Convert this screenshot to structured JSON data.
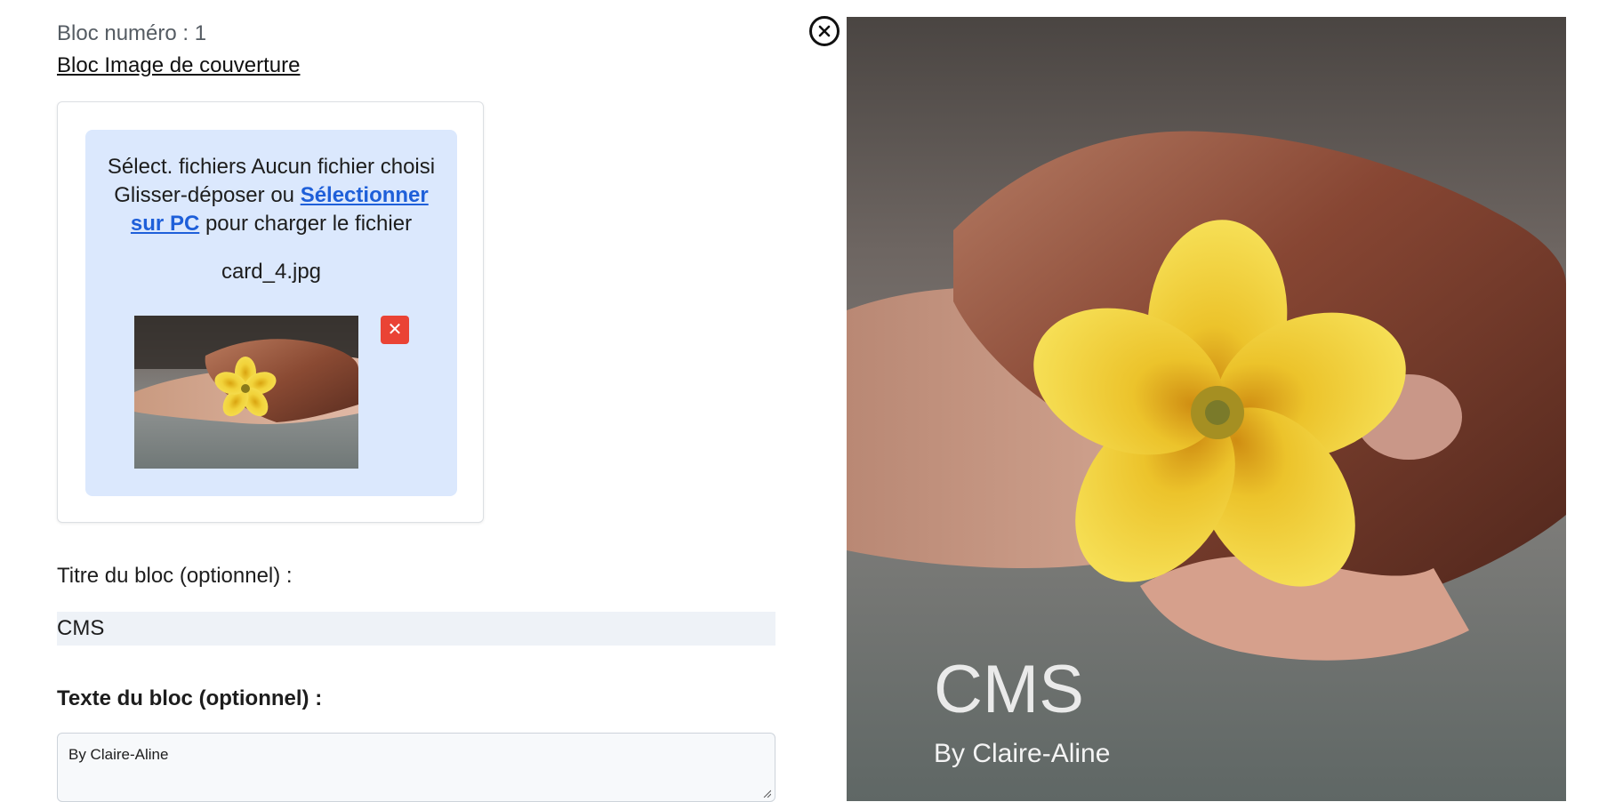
{
  "block": {
    "number_label": "Bloc numéro : 1",
    "type_link": "Bloc Image de couverture"
  },
  "upload": {
    "native_button": "Sélect. fichiers",
    "native_status": "Aucun fichier choisi",
    "drop_prefix": "Glisser-déposer ou",
    "select_link": "Sélectionner sur PC",
    "drop_suffix": "pour charger le fichier",
    "file_name": "card_4.jpg",
    "delete_symbol": "✕"
  },
  "form": {
    "title_label": "Titre du bloc (optionnel) :",
    "title_value": "CMS",
    "text_label": "Texte du bloc (optionnel) :",
    "text_value": "By Claire-Aline"
  },
  "preview": {
    "title": "CMS",
    "subtitle": "By Claire-Aline"
  },
  "colors": {
    "dropzone_bg": "#dbe8fd",
    "link_blue": "#1e5fd9",
    "delete_red": "#ea4335"
  },
  "icons": {
    "close": "close-circle-icon",
    "delete": "close-icon"
  }
}
